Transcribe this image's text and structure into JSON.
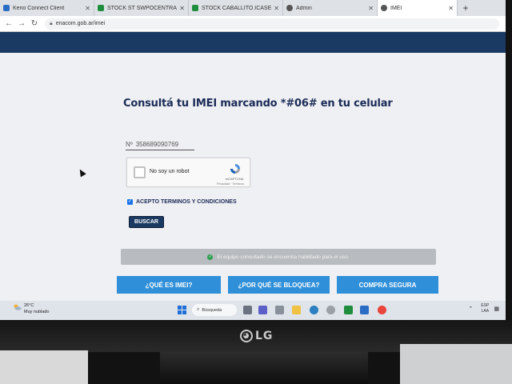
{
  "browser": {
    "tabs": [
      {
        "title": "Kerio Connect Client",
        "icon": "mail-icon",
        "color": "#2b6cc4"
      },
      {
        "title": "STOCK ST SWPOCENTRAL - ",
        "icon": "sheets-icon",
        "color": "#1e8e3e"
      },
      {
        "title": "STOCK CABALLITO.ICASE - H",
        "icon": "sheets-icon",
        "color": "#1e8e3e"
      },
      {
        "title": "Admin",
        "icon": "globe-icon",
        "color": "#555555"
      },
      {
        "title": "IMEI",
        "icon": "globe-icon",
        "color": "#555555"
      }
    ],
    "url": "enacom.gob.ar/imei"
  },
  "page": {
    "title": "Consultá tu IMEI marcando *#06# en tu celular",
    "imei_prefix": "Nº",
    "imei_value": "358689090769",
    "recaptcha": {
      "label": "No soy un robot",
      "brand": "reCAPTCHA",
      "terms": "Privacidad · Términos"
    },
    "terms_label": "ACEPTO TERMINOS Y CONDICIONES",
    "terms_checked": true,
    "search_button": "BUSCAR",
    "result_message": "El equipo consultado se encuentra habilitado para el uso.",
    "bottom_buttons": [
      "¿QUÉ ES IMEI?",
      "¿POR QUÉ SE BLOQUEA?",
      "COMPRA SEGURA"
    ],
    "colors": {
      "header": "#1b3a63",
      "title": "#1a2b57",
      "bottom_button": "#2f8fd8",
      "result_bar": "#b8bbbf"
    }
  },
  "taskbar": {
    "weather_temp": "26°C",
    "weather_desc": "Muy nublado",
    "search_label": "Búsqueda",
    "lang_top": "ESP",
    "lang_bottom": "LAA"
  },
  "monitor": {
    "brand": "LG"
  }
}
